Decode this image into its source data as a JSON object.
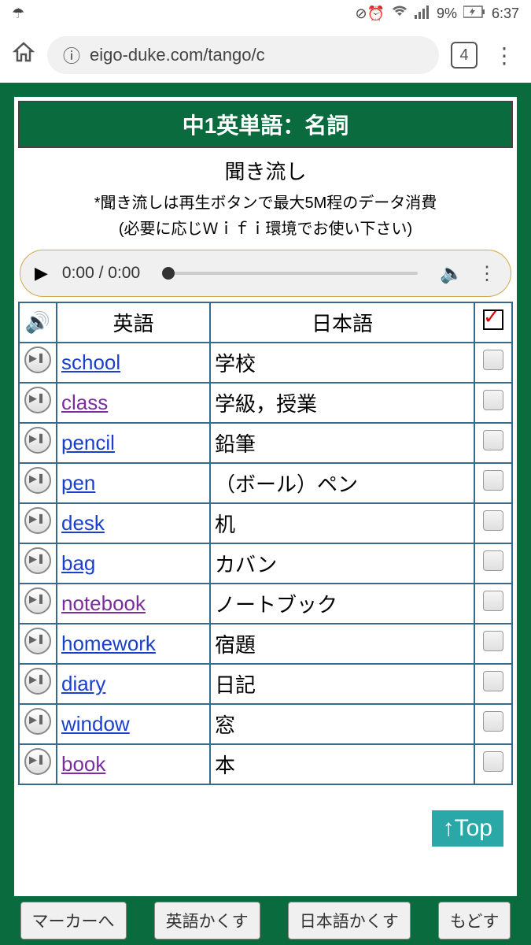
{
  "status_bar": {
    "umbrella_icon": "☂",
    "moon_icon": "◌",
    "alarm_icon": "⏰",
    "wifi_icon": "≋",
    "signal_icon": "📶",
    "battery_percent": "9%",
    "battery_icon": "🔋",
    "time": "6:37"
  },
  "browser": {
    "url": "eigo-duke.com/tango/c",
    "tab_count": "4"
  },
  "page": {
    "title": "中1英単語：名詞",
    "listen_title": "聞き流し",
    "listen_note1": "*聞き流しは再生ボタンで最大5M程のデータ消費",
    "listen_note2": "(必要に応じＷｉｆｉ環境でお使い下さい)"
  },
  "audio": {
    "time": "0:00 / 0:00"
  },
  "table": {
    "header_english": "英語",
    "header_japanese": "日本語",
    "rows": [
      {
        "english": "school",
        "japanese": "学校",
        "visited": false
      },
      {
        "english": "class",
        "japanese": "学級，授業",
        "visited": true
      },
      {
        "english": "pencil",
        "japanese": "鉛筆",
        "visited": false
      },
      {
        "english": "pen",
        "japanese": "（ボール）ペン",
        "visited": false
      },
      {
        "english": "desk",
        "japanese": "机",
        "visited": false
      },
      {
        "english": "bag",
        "japanese": "カバン",
        "visited": false
      },
      {
        "english": "notebook",
        "japanese": "ノートブック",
        "visited": true
      },
      {
        "english": "homework",
        "japanese": "宿題",
        "visited": false
      },
      {
        "english": "diary",
        "japanese": "日記",
        "visited": false
      },
      {
        "english": "window",
        "japanese": "窓",
        "visited": false
      },
      {
        "english": "book",
        "japanese": "本",
        "visited": true
      }
    ]
  },
  "top_button": "↑Top",
  "bottom_buttons": {
    "marker": "マーカーへ",
    "hide_english": "英語かくす",
    "hide_japanese": "日本語かくす",
    "restore": "もどす"
  }
}
